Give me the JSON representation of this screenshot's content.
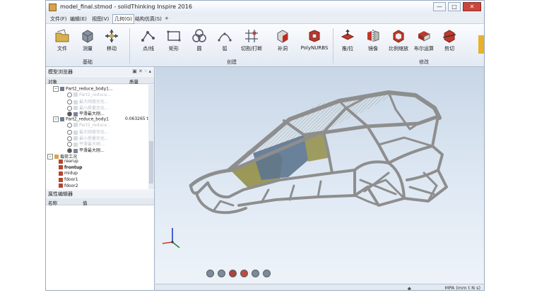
{
  "window": {
    "title": "model_final.stmod - solidThinking Inspire 2016",
    "controls": {
      "minimize": "—",
      "maximize": "□",
      "close": "✕"
    }
  },
  "menu": {
    "items": [
      "文件(F)",
      "编辑(E)",
      "视图(V)",
      "几何(G)",
      "结构仿真(S)",
      "+"
    ],
    "active_index": 3
  },
  "ribbon": {
    "groups": {
      "basic": "基础",
      "create": "创建",
      "modify": "修改"
    },
    "buttons": {
      "file": "文件",
      "measure": "测量",
      "move": "移动",
      "point_line": "点/线",
      "rect": "矩形",
      "circle": "圆",
      "arc": "弧",
      "cut_trim": "切割/打断",
      "shell": "补洞",
      "polynurbs": "PolyNURBS",
      "push_pull": "推/拉",
      "mirror": "镜像",
      "scale": "比例缩放",
      "boolean": "布尔运算",
      "cut": "剪切"
    }
  },
  "model_browser": {
    "title": "模型浏览器",
    "panel_buttons": "▣ ✕ ◦ ▴",
    "columns": {
      "object": "对象",
      "mass": "质量"
    },
    "rows": [
      {
        "text": "Part2_reduce_body1...",
        "mass": "",
        "dim": false,
        "kind": "part"
      },
      {
        "text": "Part2_reduce...",
        "mass": "",
        "dim": true,
        "kind": "radio"
      },
      {
        "text": "最大刚度优化...",
        "mass": "",
        "dim": true,
        "kind": "radio"
      },
      {
        "text": "最小质量优化...",
        "mass": "",
        "dim": true,
        "kind": "radio"
      },
      {
        "text": "平滑最大刚...",
        "mass": "",
        "dim": false,
        "kind": "radio-on"
      },
      {
        "text": "Part2_reduce_body1",
        "mass": "0.063265 t",
        "dim": false,
        "kind": "part"
      },
      {
        "text": "Part2_reduce...",
        "mass": "",
        "dim": true,
        "kind": "radio"
      },
      {
        "text": "最大刚度优化...",
        "mass": "",
        "dim": true,
        "kind": "radio"
      },
      {
        "text": "最小质量优化...",
        "mass": "",
        "dim": true,
        "kind": "radio"
      },
      {
        "text": "平滑最大刚...",
        "mass": "",
        "dim": true,
        "kind": "radio"
      },
      {
        "text": "平滑最大刚...",
        "mass": "",
        "dim": false,
        "kind": "radio-on"
      },
      {
        "text": "载荷工况",
        "mass": "",
        "dim": false,
        "kind": "folder"
      },
      {
        "text": "rearup",
        "mass": "",
        "dim": false,
        "kind": "load"
      },
      {
        "text": "frontup",
        "mass": "",
        "dim": false,
        "kind": "load-bold"
      },
      {
        "text": "midup",
        "mass": "",
        "dim": false,
        "kind": "load"
      },
      {
        "text": "fdoor1",
        "mass": "",
        "dim": false,
        "kind": "load"
      },
      {
        "text": "fdoor2",
        "mass": "",
        "dim": false,
        "kind": "load"
      }
    ]
  },
  "property_editor": {
    "title": "属性编辑器",
    "columns": {
      "name": "名称",
      "value": "值"
    }
  },
  "status": {
    "units": "MPA (mm t N s)",
    "icon": "diamond-icon"
  },
  "colors": {
    "accent": "#e7b12a",
    "frame_gray": "#8e8e8e",
    "panel_blue": "#5d7590",
    "panel_olive": "#8f8a3c",
    "edge_olive": "#8c8650"
  }
}
